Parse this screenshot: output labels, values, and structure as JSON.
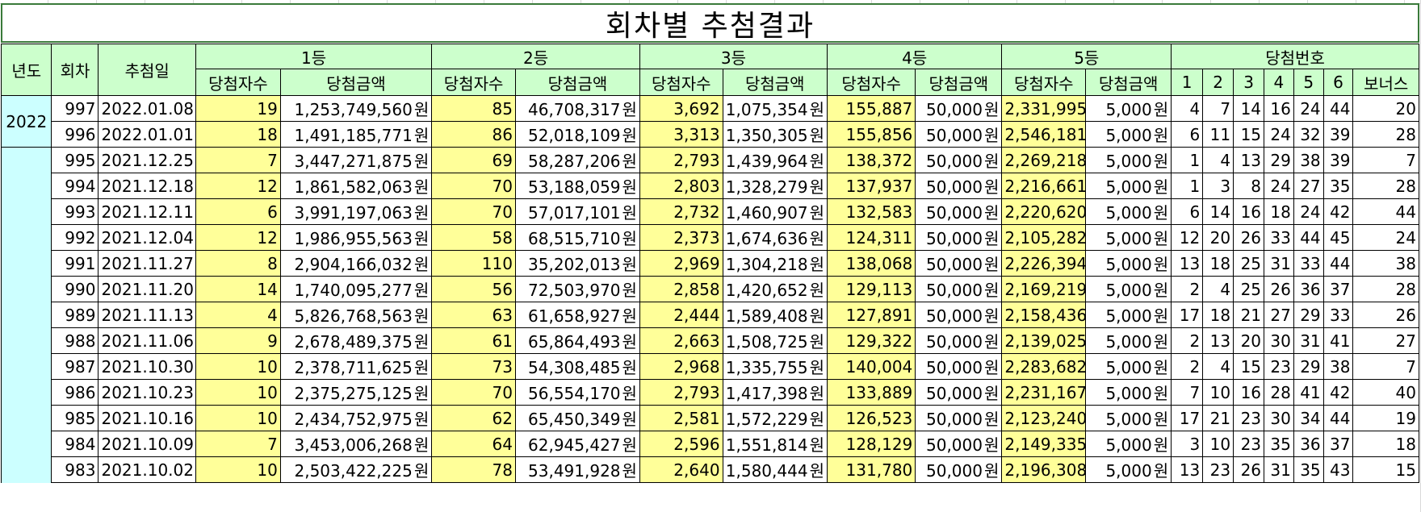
{
  "title": "회차별 추첨결과",
  "headers": {
    "year": "년도",
    "round": "회차",
    "date": "추첨일",
    "groups": [
      "1등",
      "2등",
      "3등",
      "4등",
      "5등"
    ],
    "winners": "당첨자수",
    "amount": "당첨금액",
    "numbers": "당첨번호",
    "number_cols": [
      "1",
      "2",
      "3",
      "4",
      "5",
      "6",
      "보너스"
    ]
  },
  "currency": "원",
  "years": [
    {
      "label": "2022",
      "rows": 2
    },
    {
      "label": "",
      "rows": 13
    }
  ],
  "rows": [
    {
      "round": "997",
      "date": "2022.01.08",
      "w1": "19",
      "a1": "1,253,749,560",
      "w2": "85",
      "a2": "46,708,317",
      "w3": "3,692",
      "a3": "1,075,354",
      "w4": "155,887",
      "a4": "50,000",
      "w5": "2,331,995",
      "a5": "5,000",
      "n": [
        "4",
        "7",
        "14",
        "16",
        "24",
        "44",
        "20"
      ]
    },
    {
      "round": "996",
      "date": "2022.01.01",
      "w1": "18",
      "a1": "1,491,185,771",
      "w2": "86",
      "a2": "52,018,109",
      "w3": "3,313",
      "a3": "1,350,305",
      "w4": "155,856",
      "a4": "50,000",
      "w5": "2,546,181",
      "a5": "5,000",
      "n": [
        "6",
        "11",
        "15",
        "24",
        "32",
        "39",
        "28"
      ]
    },
    {
      "round": "995",
      "date": "2021.12.25",
      "w1": "7",
      "a1": "3,447,271,875",
      "w2": "69",
      "a2": "58,287,206",
      "w3": "2,793",
      "a3": "1,439,964",
      "w4": "138,372",
      "a4": "50,000",
      "w5": "2,269,218",
      "a5": "5,000",
      "n": [
        "1",
        "4",
        "13",
        "29",
        "38",
        "39",
        "7"
      ]
    },
    {
      "round": "994",
      "date": "2021.12.18",
      "w1": "12",
      "a1": "1,861,582,063",
      "w2": "70",
      "a2": "53,188,059",
      "w3": "2,803",
      "a3": "1,328,279",
      "w4": "137,937",
      "a4": "50,000",
      "w5": "2,216,661",
      "a5": "5,000",
      "n": [
        "1",
        "3",
        "8",
        "24",
        "27",
        "35",
        "28"
      ]
    },
    {
      "round": "993",
      "date": "2021.12.11",
      "w1": "6",
      "a1": "3,991,197,063",
      "w2": "70",
      "a2": "57,017,101",
      "w3": "2,732",
      "a3": "1,460,907",
      "w4": "132,583",
      "a4": "50,000",
      "w5": "2,220,620",
      "a5": "5,000",
      "n": [
        "6",
        "14",
        "16",
        "18",
        "24",
        "42",
        "44"
      ]
    },
    {
      "round": "992",
      "date": "2021.12.04",
      "w1": "12",
      "a1": "1,986,955,563",
      "w2": "58",
      "a2": "68,515,710",
      "w3": "2,373",
      "a3": "1,674,636",
      "w4": "124,311",
      "a4": "50,000",
      "w5": "2,105,282",
      "a5": "5,000",
      "n": [
        "12",
        "20",
        "26",
        "33",
        "44",
        "45",
        "24"
      ]
    },
    {
      "round": "991",
      "date": "2021.11.27",
      "w1": "8",
      "a1": "2,904,166,032",
      "w2": "110",
      "a2": "35,202,013",
      "w3": "2,969",
      "a3": "1,304,218",
      "w4": "138,068",
      "a4": "50,000",
      "w5": "2,226,394",
      "a5": "5,000",
      "n": [
        "13",
        "18",
        "25",
        "31",
        "33",
        "44",
        "38"
      ]
    },
    {
      "round": "990",
      "date": "2021.11.20",
      "w1": "14",
      "a1": "1,740,095,277",
      "w2": "56",
      "a2": "72,503,970",
      "w3": "2,858",
      "a3": "1,420,652",
      "w4": "129,113",
      "a4": "50,000",
      "w5": "2,169,219",
      "a5": "5,000",
      "n": [
        "2",
        "4",
        "25",
        "26",
        "36",
        "37",
        "28"
      ]
    },
    {
      "round": "989",
      "date": "2021.11.13",
      "w1": "4",
      "a1": "5,826,768,563",
      "w2": "63",
      "a2": "61,658,927",
      "w3": "2,444",
      "a3": "1,589,408",
      "w4": "127,891",
      "a4": "50,000",
      "w5": "2,158,436",
      "a5": "5,000",
      "n": [
        "17",
        "18",
        "21",
        "27",
        "29",
        "33",
        "26"
      ]
    },
    {
      "round": "988",
      "date": "2021.11.06",
      "w1": "9",
      "a1": "2,678,489,375",
      "w2": "61",
      "a2": "65,864,493",
      "w3": "2,663",
      "a3": "1,508,725",
      "w4": "129,322",
      "a4": "50,000",
      "w5": "2,139,025",
      "a5": "5,000",
      "n": [
        "2",
        "13",
        "20",
        "30",
        "31",
        "41",
        "27"
      ]
    },
    {
      "round": "987",
      "date": "2021.10.30",
      "w1": "10",
      "a1": "2,378,711,625",
      "w2": "73",
      "a2": "54,308,485",
      "w3": "2,968",
      "a3": "1,335,755",
      "w4": "140,004",
      "a4": "50,000",
      "w5": "2,283,682",
      "a5": "5,000",
      "n": [
        "2",
        "4",
        "15",
        "23",
        "29",
        "38",
        "7"
      ]
    },
    {
      "round": "986",
      "date": "2021.10.23",
      "w1": "10",
      "a1": "2,375,275,125",
      "w2": "70",
      "a2": "56,554,170",
      "w3": "2,793",
      "a3": "1,417,398",
      "w4": "133,889",
      "a4": "50,000",
      "w5": "2,231,167",
      "a5": "5,000",
      "n": [
        "7",
        "10",
        "16",
        "28",
        "41",
        "42",
        "40"
      ]
    },
    {
      "round": "985",
      "date": "2021.10.16",
      "w1": "10",
      "a1": "2,434,752,975",
      "w2": "62",
      "a2": "65,450,349",
      "w3": "2,581",
      "a3": "1,572,229",
      "w4": "126,523",
      "a4": "50,000",
      "w5": "2,123,240",
      "a5": "5,000",
      "n": [
        "17",
        "21",
        "23",
        "30",
        "34",
        "44",
        "19"
      ]
    },
    {
      "round": "984",
      "date": "2021.10.09",
      "w1": "7",
      "a1": "3,453,006,268",
      "w2": "64",
      "a2": "62,945,427",
      "w3": "2,596",
      "a3": "1,551,814",
      "w4": "128,129",
      "a4": "50,000",
      "w5": "2,149,335",
      "a5": "5,000",
      "n": [
        "3",
        "10",
        "23",
        "35",
        "36",
        "37",
        "18"
      ]
    },
    {
      "round": "983",
      "date": "2021.10.02",
      "w1": "10",
      "a1": "2,503,422,225",
      "w2": "78",
      "a2": "53,491,928",
      "w3": "2,640",
      "a3": "1,580,444",
      "w4": "131,780",
      "a4": "50,000",
      "w5": "2,196,308",
      "a5": "5,000",
      "n": [
        "13",
        "23",
        "26",
        "31",
        "35",
        "43",
        "15"
      ]
    }
  ]
}
